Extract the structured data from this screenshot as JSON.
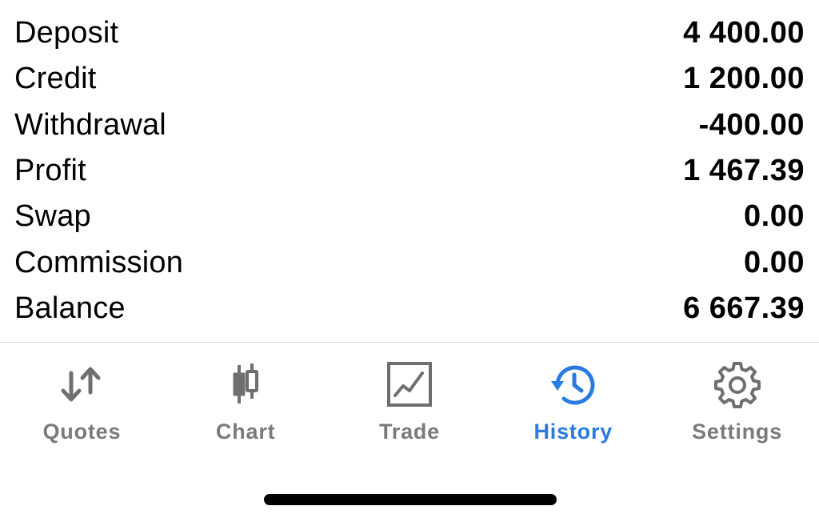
{
  "summary": {
    "rows": [
      {
        "label": "Deposit",
        "value": "4 400.00"
      },
      {
        "label": "Credit",
        "value": "1 200.00"
      },
      {
        "label": "Withdrawal",
        "value": "-400.00"
      },
      {
        "label": "Profit",
        "value": "1 467.39"
      },
      {
        "label": "Swap",
        "value": "0.00"
      },
      {
        "label": "Commission",
        "value": "0.00"
      },
      {
        "label": "Balance",
        "value": "6 667.39"
      }
    ]
  },
  "tabbar": {
    "tabs": [
      {
        "label": "Quotes",
        "icon": "quotes-arrows-icon",
        "active": false
      },
      {
        "label": "Chart",
        "icon": "candlestick-icon",
        "active": false
      },
      {
        "label": "Trade",
        "icon": "trade-chart-icon",
        "active": false
      },
      {
        "label": "History",
        "icon": "history-clock-icon",
        "active": true
      },
      {
        "label": "Settings",
        "icon": "gear-icon",
        "active": false
      }
    ]
  },
  "colors": {
    "active": "#2a7ae2",
    "inactive": "#7a7a7a",
    "text": "#000000"
  }
}
